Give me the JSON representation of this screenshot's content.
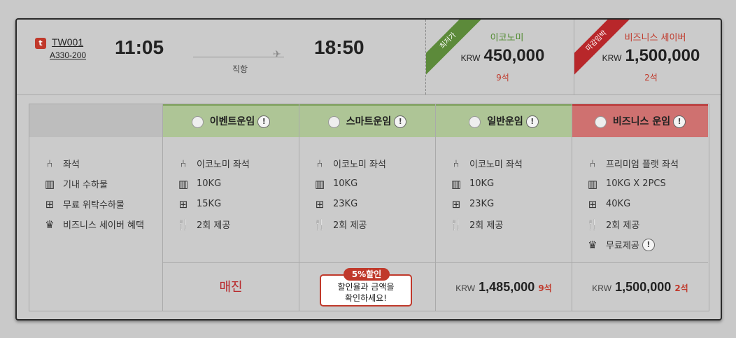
{
  "flight": {
    "logo_glyph": "t",
    "number": "TW001",
    "aircraft": "A330-200",
    "departure_time": "11:05",
    "arrival_time": "18:50",
    "route_type": "직항"
  },
  "fares": [
    {
      "ribbon": "최저가",
      "name": "이코노미",
      "currency": "KRW",
      "price": "450,000",
      "seats": "9석",
      "ribbon_color": "#5c8a3a"
    },
    {
      "ribbon": "마감임박",
      "name": "비즈니스 세이버",
      "currency": "KRW",
      "price": "1,500,000",
      "seats": "2석",
      "ribbon_color": "#b8272a"
    }
  ],
  "features": [
    "좌석",
    "기내 수하물",
    "무료 위탁수하물",
    "비즈니스 세이버 혜택"
  ],
  "columns": [
    {
      "name": "이벤트운임",
      "info": "!",
      "items": [
        "이코노미 좌석",
        "10KG",
        "15KG",
        "2회 제공"
      ],
      "status": "매진"
    },
    {
      "name": "스마트운임",
      "info": "!",
      "items": [
        "이코노미 좌석",
        "10KG",
        "23KG",
        "2회 제공"
      ],
      "promo_tag": "5%할인",
      "promo_line1": "할인율과 금액을",
      "promo_line2": "확인하세요!"
    },
    {
      "name": "일반운임",
      "info": "!",
      "items": [
        "이코노미 좌석",
        "10KG",
        "23KG",
        "2회 제공"
      ],
      "currency": "KRW",
      "price": "1,485,000",
      "seats": "9석"
    },
    {
      "name": "비즈니스 운임",
      "info": "!",
      "items": [
        "프리미엄 플랫 좌석",
        "10KG X 2PCS",
        "40KG",
        "2회 제공",
        "무료제공"
      ],
      "currency": "KRW",
      "price": "1,500,000",
      "seats": "2석"
    }
  ],
  "colors": {
    "economy_header": "#aec596",
    "business_header": "#cf7170",
    "accent_red": "#c0392b",
    "accent_green": "#4f8a2e"
  }
}
